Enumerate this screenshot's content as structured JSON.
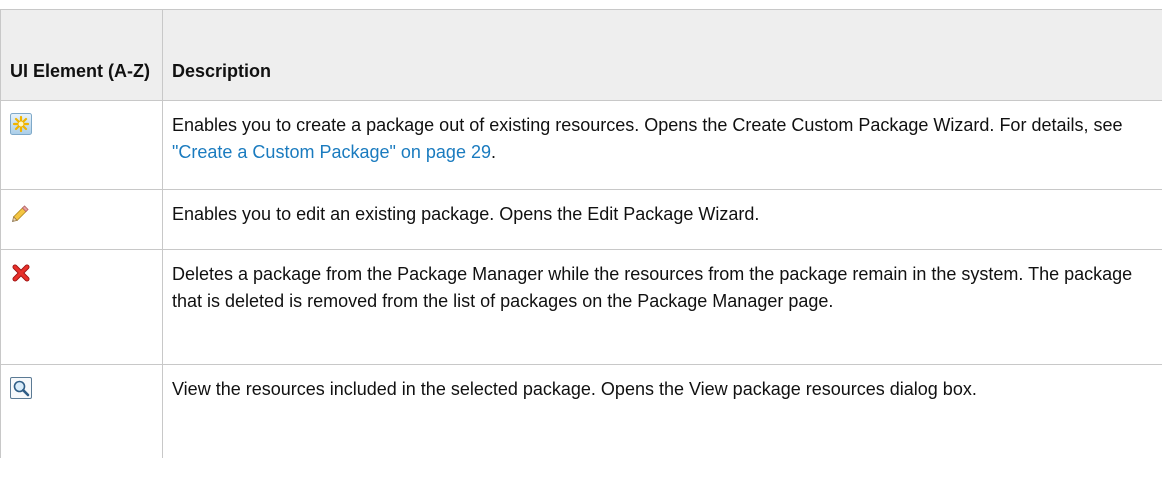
{
  "table": {
    "headers": {
      "element": "UI Element (A-Z)",
      "description": "Description"
    },
    "rows": [
      {
        "icon": "new-package-icon",
        "description_before": "Enables you to create a package out of existing resources. Opens the Create Custom Package Wizard. For details, see ",
        "link_text": "\"Create a Custom Package\" on page 29",
        "description_after": "."
      },
      {
        "icon": "pencil-edit-icon",
        "description": "Enables you to edit an existing package. Opens the Edit Package Wizard."
      },
      {
        "icon": "delete-x-icon",
        "description": "Deletes a package from the Package Manager while the resources from the package remain in the system. The package that is deleted is removed from the list of packages on the Package Manager page."
      },
      {
        "icon": "magnifier-view-icon",
        "description": "View the resources included in the selected package. Opens the View package resources dialog box."
      }
    ]
  },
  "colors": {
    "link": "#1a7bbf",
    "header_bg": "#eeeeee",
    "border": "#c8c8c8"
  }
}
